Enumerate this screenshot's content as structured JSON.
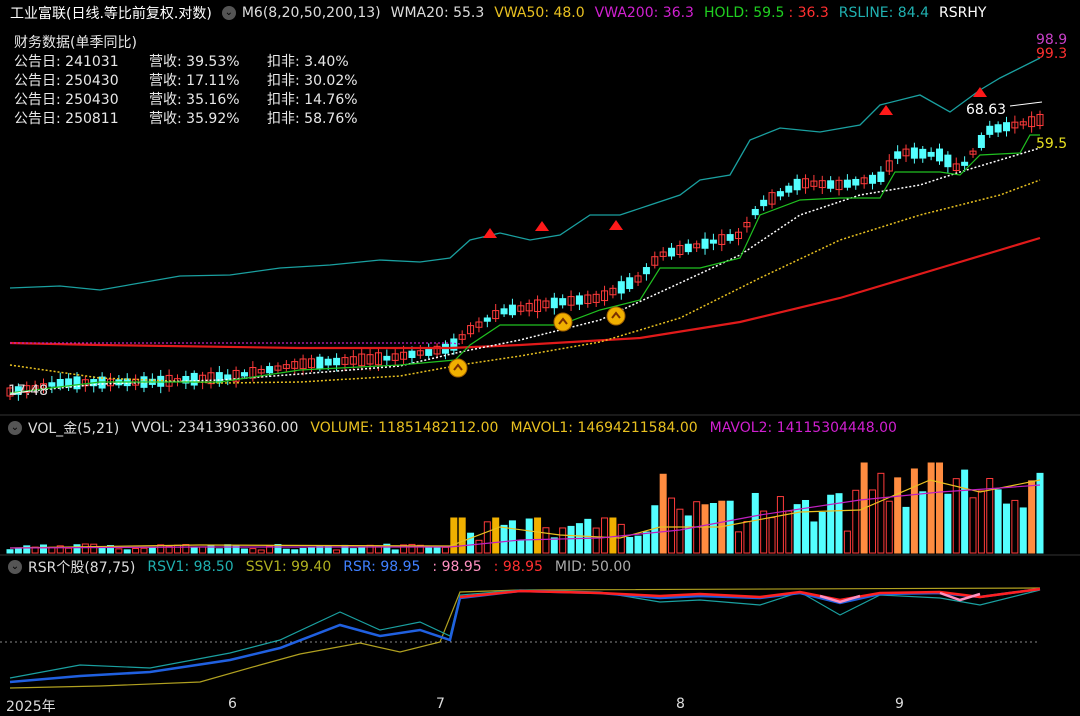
{
  "header": {
    "title": "工业富联(日线.等比前复权.对数)",
    "m6": "M6(8,20,50,200,13)",
    "wma20": "WMA20: 55.3",
    "vwa50": "VWA50: 48.0",
    "vwa200": "VWA200: 36.3",
    "hold": "HOLD: 59.5",
    "hold2": ": 36.3",
    "rsline": "RSLINE: 84.4",
    "rsrhy": "RSRHY"
  },
  "financials": {
    "title": "财务数据(单季同比)",
    "rows": [
      {
        "date": "公告日: 241031",
        "rev": "营收: 39.53%",
        "net": "扣非: 3.40%"
      },
      {
        "date": "公告日: 250430",
        "rev": "营收: 17.11%",
        "net": "扣非: 30.02%"
      },
      {
        "date": "公告日: 250430",
        "rev": "营收: 35.16%",
        "net": "扣非: 14.76%"
      },
      {
        "date": "公告日: 250811",
        "rev": "营收: 35.92%",
        "net": "扣非: 58.76%"
      }
    ]
  },
  "price_labels": {
    "top1": "98.9",
    "top2": "99.3",
    "high": "68.63",
    "hold": "59.5",
    "low": "17.48"
  },
  "volume_panel": {
    "name": "VOL_金(5,21)",
    "vvol": "VVOL: 23413903360.00",
    "volume": "VOLUME: 11851482112.00",
    "mavol1": "MAVOL1: 14694211584.00",
    "mavol2": "MAVOL2: 14115304448.00"
  },
  "rsr_panel": {
    "name": "RSR个股(87,75)",
    "rsv1": "RSV1: 98.50",
    "ssv1": "SSV1: 99.40",
    "rsr": "RSR: 98.95",
    "v1": ": 98.95",
    "v2": ": 98.95",
    "mid": "MID: 50.00"
  },
  "xaxis": [
    "2025年",
    "6",
    "7",
    "8",
    "9"
  ],
  "colors": {
    "up": "#ff3b3b",
    "down": "#54ffff",
    "wma": "#ffffff",
    "vwa50": "#e8c020",
    "vwa200": "#e01a1a",
    "hold": "#20c020",
    "rsline": "#1aa0a0",
    "vol_orange": "#ff8c40",
    "vol_yellow": "#f0b000",
    "magenta": "#c020c0"
  }
}
